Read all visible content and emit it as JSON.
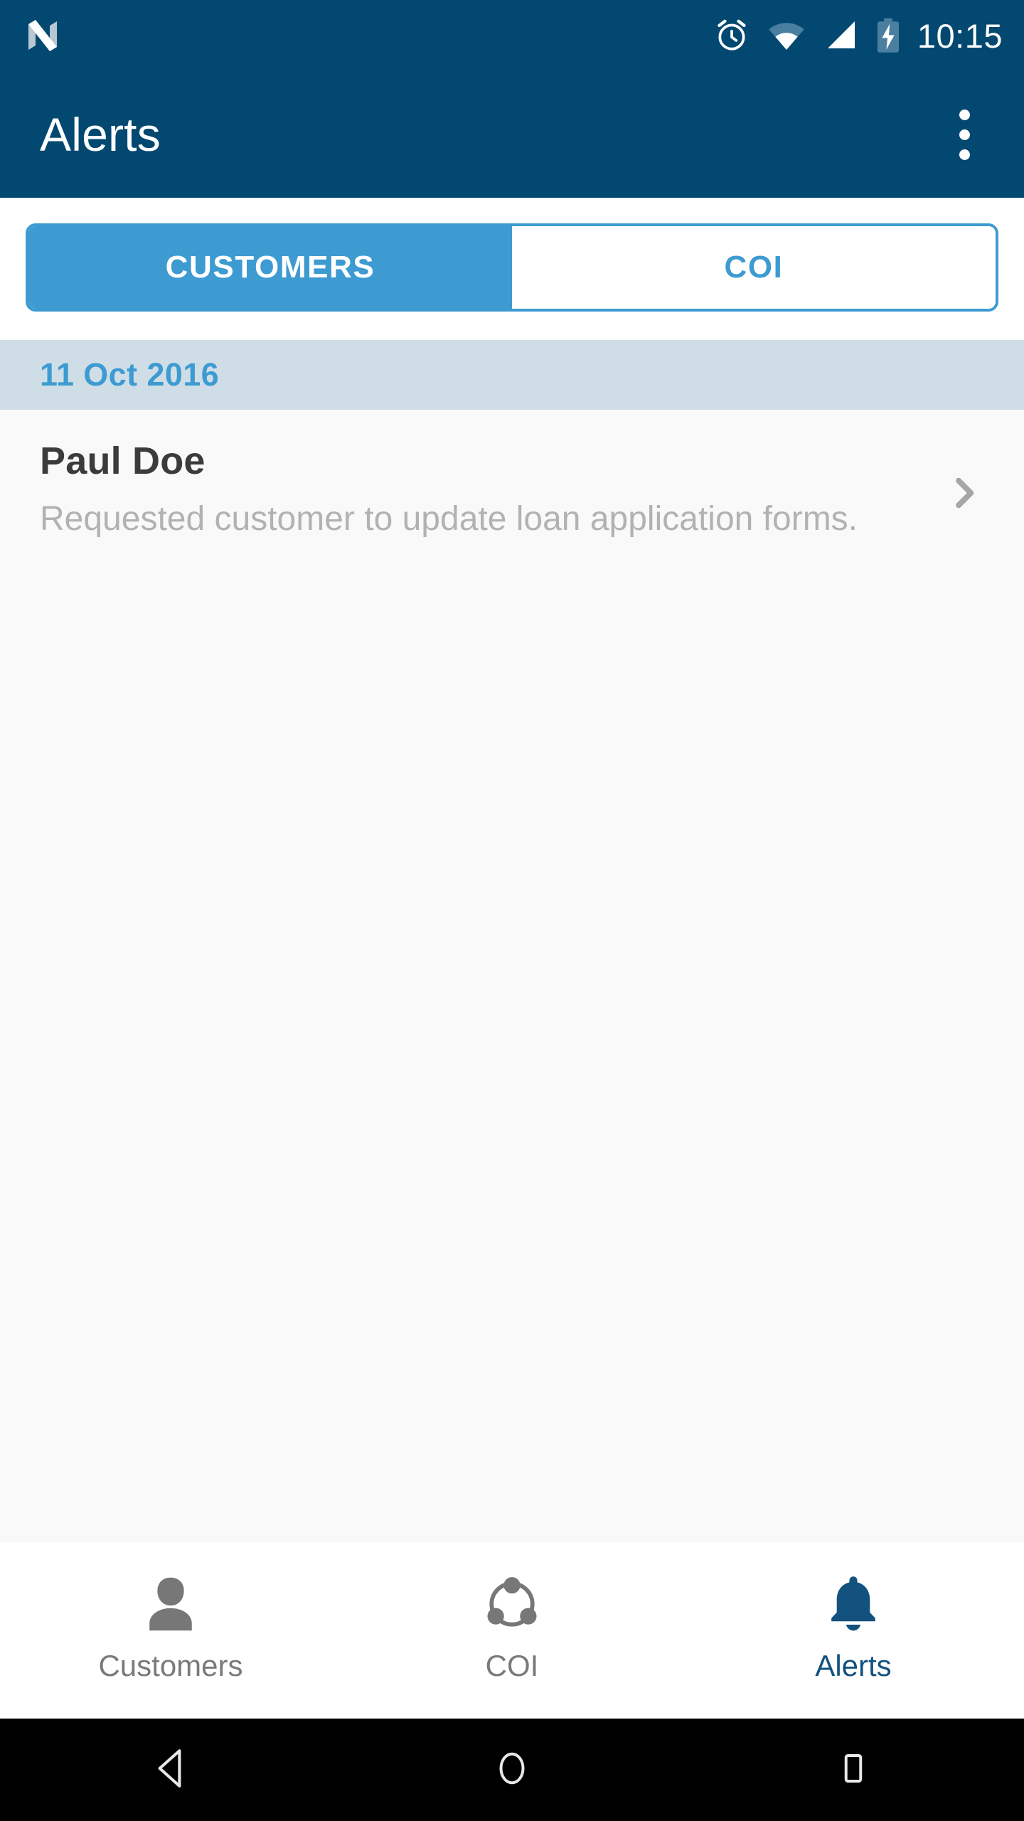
{
  "status_bar": {
    "os_logo": "android-n-logo",
    "icons": [
      "alarm-icon",
      "wifi-icon",
      "cellular-signal-icon",
      "battery-charging-icon"
    ],
    "clock": "10:15",
    "background_color": "#024871"
  },
  "app_bar": {
    "title": "Alerts",
    "overflow_menu": "more-options",
    "background_color": "#024871",
    "title_color": "#ffffff"
  },
  "tabs": {
    "active_index": 0,
    "accent_color": "#3d9bd2",
    "items": [
      {
        "label": "CUSTOMERS",
        "active": true
      },
      {
        "label": "COI",
        "active": false
      }
    ]
  },
  "list": {
    "background_color": "#f9f9f9",
    "groups": [
      {
        "date": "11 Oct 2016",
        "date_color": "#3d9bd2",
        "date_background": "#cfdee6",
        "items": [
          {
            "title": "Paul Doe",
            "subtitle": "Requested customer to update loan application forms.",
            "chevron": "chevron-right-icon"
          }
        ]
      }
    ]
  },
  "bottom_nav": {
    "active_index": 2,
    "active_color": "#13527f",
    "inactive_color": "#7a7a7a",
    "items": [
      {
        "label": "Customers",
        "icon": "person-icon",
        "active": false
      },
      {
        "label": "COI",
        "icon": "network-nodes-icon",
        "active": false
      },
      {
        "label": "Alerts",
        "icon": "bell-icon",
        "active": true
      }
    ]
  },
  "android_nav": {
    "background_color": "#000000",
    "buttons": [
      {
        "name": "back-button",
        "icon": "triangle-back-icon"
      },
      {
        "name": "home-button",
        "icon": "circle-home-icon"
      },
      {
        "name": "recents-button",
        "icon": "square-recents-icon"
      }
    ]
  }
}
